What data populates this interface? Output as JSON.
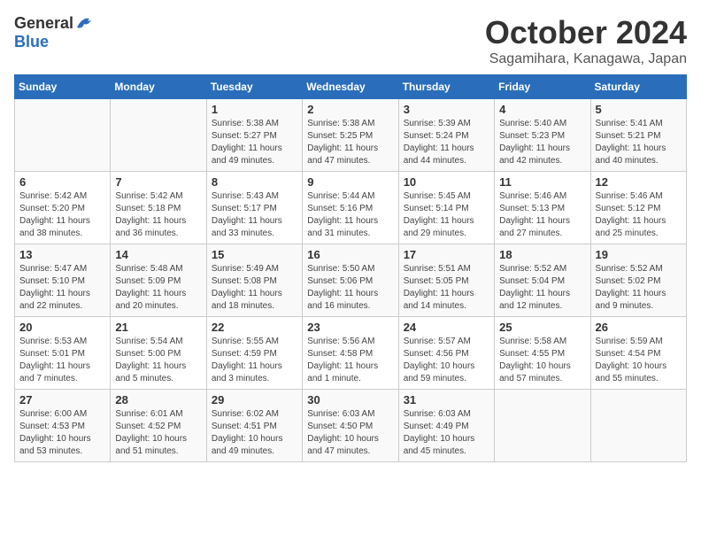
{
  "header": {
    "logo_general": "General",
    "logo_blue": "Blue",
    "month": "October 2024",
    "location": "Sagamihara, Kanagawa, Japan"
  },
  "weekdays": [
    "Sunday",
    "Monday",
    "Tuesday",
    "Wednesday",
    "Thursday",
    "Friday",
    "Saturday"
  ],
  "weeks": [
    [
      {
        "day": "",
        "info": ""
      },
      {
        "day": "",
        "info": ""
      },
      {
        "day": "1",
        "info": "Sunrise: 5:38 AM\nSunset: 5:27 PM\nDaylight: 11 hours and 49 minutes."
      },
      {
        "day": "2",
        "info": "Sunrise: 5:38 AM\nSunset: 5:25 PM\nDaylight: 11 hours and 47 minutes."
      },
      {
        "day": "3",
        "info": "Sunrise: 5:39 AM\nSunset: 5:24 PM\nDaylight: 11 hours and 44 minutes."
      },
      {
        "day": "4",
        "info": "Sunrise: 5:40 AM\nSunset: 5:23 PM\nDaylight: 11 hours and 42 minutes."
      },
      {
        "day": "5",
        "info": "Sunrise: 5:41 AM\nSunset: 5:21 PM\nDaylight: 11 hours and 40 minutes."
      }
    ],
    [
      {
        "day": "6",
        "info": "Sunrise: 5:42 AM\nSunset: 5:20 PM\nDaylight: 11 hours and 38 minutes."
      },
      {
        "day": "7",
        "info": "Sunrise: 5:42 AM\nSunset: 5:18 PM\nDaylight: 11 hours and 36 minutes."
      },
      {
        "day": "8",
        "info": "Sunrise: 5:43 AM\nSunset: 5:17 PM\nDaylight: 11 hours and 33 minutes."
      },
      {
        "day": "9",
        "info": "Sunrise: 5:44 AM\nSunset: 5:16 PM\nDaylight: 11 hours and 31 minutes."
      },
      {
        "day": "10",
        "info": "Sunrise: 5:45 AM\nSunset: 5:14 PM\nDaylight: 11 hours and 29 minutes."
      },
      {
        "day": "11",
        "info": "Sunrise: 5:46 AM\nSunset: 5:13 PM\nDaylight: 11 hours and 27 minutes."
      },
      {
        "day": "12",
        "info": "Sunrise: 5:46 AM\nSunset: 5:12 PM\nDaylight: 11 hours and 25 minutes."
      }
    ],
    [
      {
        "day": "13",
        "info": "Sunrise: 5:47 AM\nSunset: 5:10 PM\nDaylight: 11 hours and 22 minutes."
      },
      {
        "day": "14",
        "info": "Sunrise: 5:48 AM\nSunset: 5:09 PM\nDaylight: 11 hours and 20 minutes."
      },
      {
        "day": "15",
        "info": "Sunrise: 5:49 AM\nSunset: 5:08 PM\nDaylight: 11 hours and 18 minutes."
      },
      {
        "day": "16",
        "info": "Sunrise: 5:50 AM\nSunset: 5:06 PM\nDaylight: 11 hours and 16 minutes."
      },
      {
        "day": "17",
        "info": "Sunrise: 5:51 AM\nSunset: 5:05 PM\nDaylight: 11 hours and 14 minutes."
      },
      {
        "day": "18",
        "info": "Sunrise: 5:52 AM\nSunset: 5:04 PM\nDaylight: 11 hours and 12 minutes."
      },
      {
        "day": "19",
        "info": "Sunrise: 5:52 AM\nSunset: 5:02 PM\nDaylight: 11 hours and 9 minutes."
      }
    ],
    [
      {
        "day": "20",
        "info": "Sunrise: 5:53 AM\nSunset: 5:01 PM\nDaylight: 11 hours and 7 minutes."
      },
      {
        "day": "21",
        "info": "Sunrise: 5:54 AM\nSunset: 5:00 PM\nDaylight: 11 hours and 5 minutes."
      },
      {
        "day": "22",
        "info": "Sunrise: 5:55 AM\nSunset: 4:59 PM\nDaylight: 11 hours and 3 minutes."
      },
      {
        "day": "23",
        "info": "Sunrise: 5:56 AM\nSunset: 4:58 PM\nDaylight: 11 hours and 1 minute."
      },
      {
        "day": "24",
        "info": "Sunrise: 5:57 AM\nSunset: 4:56 PM\nDaylight: 10 hours and 59 minutes."
      },
      {
        "day": "25",
        "info": "Sunrise: 5:58 AM\nSunset: 4:55 PM\nDaylight: 10 hours and 57 minutes."
      },
      {
        "day": "26",
        "info": "Sunrise: 5:59 AM\nSunset: 4:54 PM\nDaylight: 10 hours and 55 minutes."
      }
    ],
    [
      {
        "day": "27",
        "info": "Sunrise: 6:00 AM\nSunset: 4:53 PM\nDaylight: 10 hours and 53 minutes."
      },
      {
        "day": "28",
        "info": "Sunrise: 6:01 AM\nSunset: 4:52 PM\nDaylight: 10 hours and 51 minutes."
      },
      {
        "day": "29",
        "info": "Sunrise: 6:02 AM\nSunset: 4:51 PM\nDaylight: 10 hours and 49 minutes."
      },
      {
        "day": "30",
        "info": "Sunrise: 6:03 AM\nSunset: 4:50 PM\nDaylight: 10 hours and 47 minutes."
      },
      {
        "day": "31",
        "info": "Sunrise: 6:03 AM\nSunset: 4:49 PM\nDaylight: 10 hours and 45 minutes."
      },
      {
        "day": "",
        "info": ""
      },
      {
        "day": "",
        "info": ""
      }
    ]
  ]
}
